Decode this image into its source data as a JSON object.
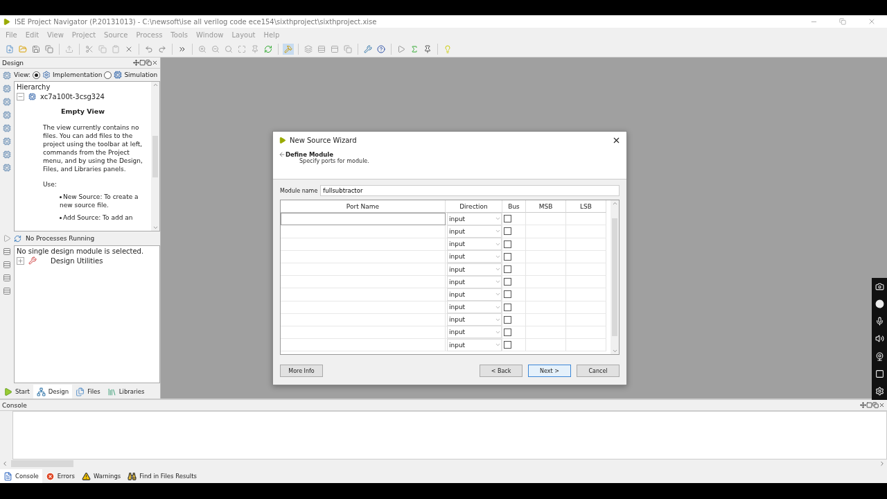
{
  "window": {
    "title": "ISE Project Navigator (P.20131013) - C:\\newsoft\\ise all verilog code ece154\\sixthproject\\sixthproject.xise"
  },
  "menu": [
    "File",
    "Edit",
    "View",
    "Project",
    "Source",
    "Process",
    "Tools",
    "Window",
    "Layout",
    "Help"
  ],
  "design_panel": {
    "title": "Design",
    "view_label": "View:",
    "views": [
      {
        "label": "Implementation",
        "selected": true
      },
      {
        "label": "Simulation",
        "selected": false
      }
    ],
    "hierarchy_label": "Hierarchy",
    "device": "xc7a100t-3csg324",
    "empty_title": "Empty View",
    "empty_text": "The view currently contains no files. You can add files to the project using the toolbar at left, commands from the Project menu, and by using the Design, Files, and Libraries panels.",
    "use_label": "Use:",
    "bullets": [
      "New Source: To create a new source file.",
      "Add Source: To add an"
    ],
    "process_status": "No Processes Running",
    "process_message": "No single design module is selected.",
    "design_utilities": "Design Utilities",
    "tabs": [
      {
        "label": "Start",
        "selected": false
      },
      {
        "label": "Design",
        "selected": true
      },
      {
        "label": "Files",
        "selected": false
      },
      {
        "label": "Libraries",
        "selected": false
      }
    ]
  },
  "dialog": {
    "title": "New Source Wizard",
    "step": "Define Module",
    "step_hint": "Specify ports for module.",
    "module_label": "Module name",
    "module_name": "fullsubtractor",
    "columns": [
      "Port Name",
      "Direction",
      "Bus",
      "MSB",
      "LSB"
    ],
    "rows": [
      {
        "direction": "input",
        "bus": false
      },
      {
        "direction": "input",
        "bus": false
      },
      {
        "direction": "input",
        "bus": false
      },
      {
        "direction": "input",
        "bus": false
      },
      {
        "direction": "input",
        "bus": false
      },
      {
        "direction": "input",
        "bus": false
      },
      {
        "direction": "input",
        "bus": false
      },
      {
        "direction": "input",
        "bus": false
      },
      {
        "direction": "input",
        "bus": false
      },
      {
        "direction": "input",
        "bus": false
      },
      {
        "direction": "input",
        "bus": false
      }
    ],
    "buttons": {
      "more_info": "More Info",
      "back": "< Back",
      "next": "Next >",
      "cancel": "Cancel"
    }
  },
  "console": {
    "title": "Console",
    "tabs": [
      {
        "label": "Console",
        "selected": true,
        "kind": "console"
      },
      {
        "label": "Errors",
        "selected": false,
        "kind": "errors"
      },
      {
        "label": "Warnings",
        "selected": false,
        "kind": "warnings"
      },
      {
        "label": "Find in Files Results",
        "selected": false,
        "kind": "find"
      }
    ]
  }
}
